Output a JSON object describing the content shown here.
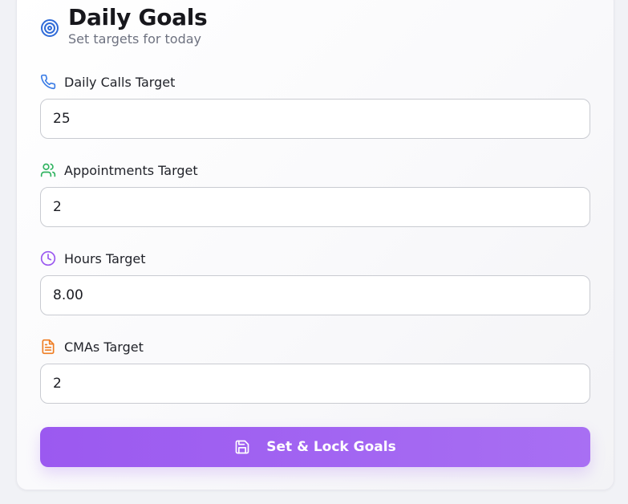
{
  "header": {
    "title": "Daily Goals",
    "subtitle": "Set targets for today",
    "icon": "target-icon",
    "icon_color": "#2f6bd8"
  },
  "fields": [
    {
      "label": "Daily Calls Target",
      "value": "25",
      "icon": "phone-icon",
      "icon_color": "#3d7ee6"
    },
    {
      "label": "Appointments Target",
      "value": "2",
      "icon": "users-icon",
      "icon_color": "#2fb360"
    },
    {
      "label": "Hours Target",
      "value": "8.00",
      "icon": "clock-icon",
      "icon_color": "#9b59f0"
    },
    {
      "label": "CMAs Target",
      "value": "2",
      "icon": "document-icon",
      "icon_color": "#ef7d22"
    }
  ],
  "button": {
    "label": "Set & Lock Goals",
    "icon": "save-icon",
    "color": "#9b59f0"
  }
}
